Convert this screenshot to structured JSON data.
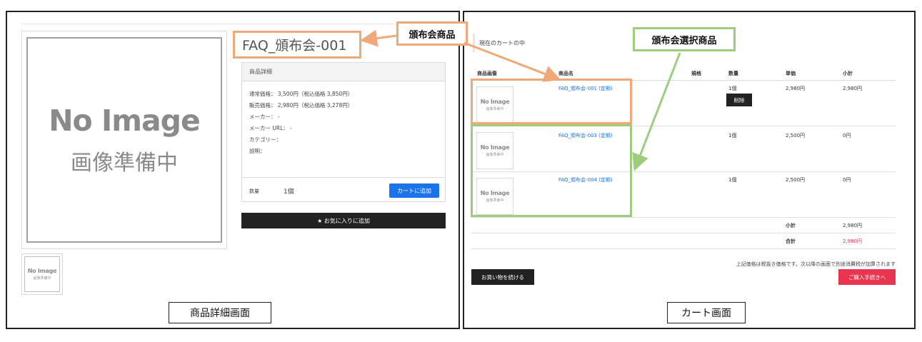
{
  "product_detail": {
    "caption": "商品詳細画面",
    "main_image": {
      "text_en": "No Image",
      "text_jp": "画像準備中"
    },
    "title": "FAQ_頒布会-001",
    "detail_header": "商品詳細",
    "lines": [
      "通常価格： 3,500円（税込価格 3,850円）",
      "販売価格： 2,980円（税込価格 3,278円）",
      "メーカー： -",
      "メーカー URL： -",
      "カテゴリー：",
      "説明："
    ],
    "qty_label": "数量",
    "qty_value": "1個",
    "add_to_cart": "カートに追加",
    "favorite_label": "★ お気に入りに追加"
  },
  "cart": {
    "caption": "カート画面",
    "heading": "現在のカートの中",
    "columns": [
      "商品画像",
      "商品名",
      "規格",
      "数量",
      "単価",
      "小計"
    ],
    "rows": [
      {
        "name": "FAQ_頒布会-001 (定期)",
        "qty": "1個",
        "unit": "2,980円",
        "subtotal": "2,980円",
        "delete": "削除"
      },
      {
        "name": "FAQ_頒布会-003 (定期)",
        "qty": "1個",
        "unit": "2,500円",
        "subtotal": "0円"
      },
      {
        "name": "FAQ_頒布会-004 (定期)",
        "qty": "1個",
        "unit": "2,500円",
        "subtotal": "0円"
      }
    ],
    "thumb_text_en": "No Image",
    "thumb_text_jp": "画像準備中",
    "subtotal_label": "小計",
    "subtotal_value": "2,980円",
    "total_label": "合計",
    "total_value": "2,980円",
    "tax_note": "上記価格は税抜き価格です。次以降の画面で別途消費税が加算されます",
    "continue_label": "お買い物を続ける",
    "checkout_label": "ご購入手続きへ"
  },
  "callouts": {
    "subscription_product": "頒布会商品",
    "subscription_selected": "頒布会選択商品"
  },
  "colors": {
    "orange_highlight": "#f0a878",
    "green_highlight": "#9dcc7e",
    "link_blue": "#1a73e8",
    "checkout_red": "#e8344e",
    "total_red": "#e8344e"
  }
}
